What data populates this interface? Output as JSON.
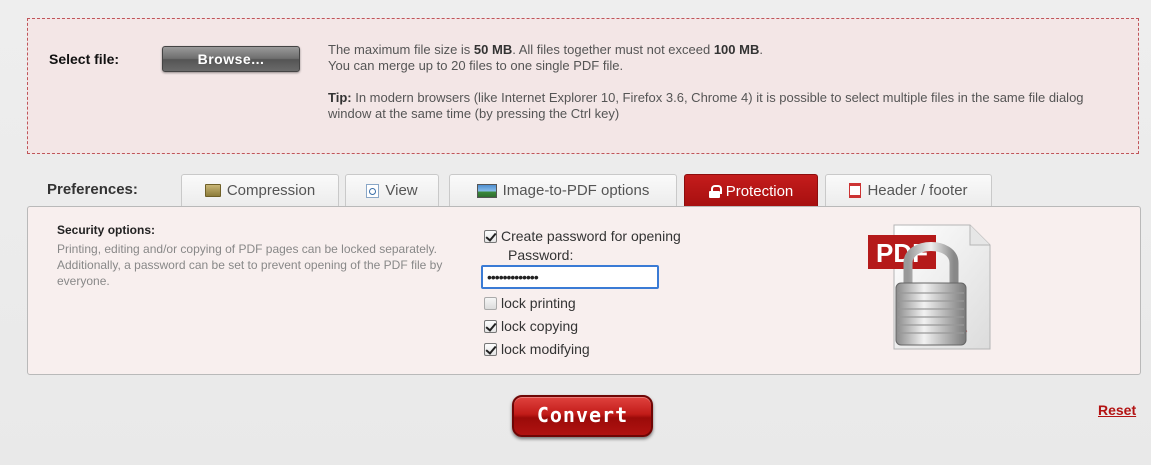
{
  "upload": {
    "select_label": "Select file:",
    "browse_label": "Browse...",
    "info_line1_pre": "The maximum file size is ",
    "max_file_size": "50 MB",
    "info_line1_mid": ". All files together must not exceed ",
    "max_total_size": "100 MB",
    "info_line1_post": ".",
    "info_line2": "You can merge up to 20 files to one single PDF file.",
    "tip_label": "Tip:",
    "tip_text": " In modern browsers (like Internet Explorer 10, Firefox 3.6, Chrome 4) it is possible to select multiple files in the same file dialog window at the same time (by pressing the Ctrl key)"
  },
  "preferences": {
    "label": "Preferences:",
    "tabs": [
      {
        "label": "Compression",
        "icon": "compression-icon",
        "active": false
      },
      {
        "label": "View",
        "icon": "view-icon",
        "active": false
      },
      {
        "label": "Image-to-PDF options",
        "icon": "image-icon",
        "active": false
      },
      {
        "label": "Protection",
        "icon": "lock-icon",
        "active": true
      },
      {
        "label": "Header / footer",
        "icon": "header-footer-icon",
        "active": false
      }
    ]
  },
  "protection": {
    "title": "Security options:",
    "desc_line1": "Printing, editing and/or copying of PDF pages can be locked separately.",
    "desc_line2": "Additionally, a password can be set to prevent opening of the PDF file by everyone.",
    "create_password_label": "Create password for opening",
    "create_password_checked": true,
    "password_label": "Password:",
    "password_value": "•••••••••••••",
    "options": [
      {
        "label": "lock printing",
        "checked": false
      },
      {
        "label": "lock copying",
        "checked": true
      },
      {
        "label": "lock modifying",
        "checked": true
      }
    ],
    "image_text": "PDF"
  },
  "actions": {
    "convert_label": "Convert",
    "reset_label": "Reset"
  },
  "colors": {
    "accent": "#b31313",
    "active_tab": "#c41c1c",
    "upload_bg": "#f3e6e6",
    "panel_bg": "#f8efee"
  }
}
